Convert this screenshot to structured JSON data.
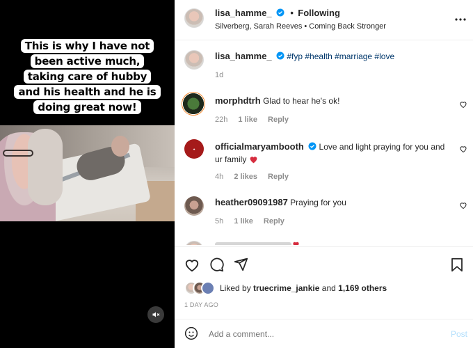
{
  "media": {
    "caption_lines": [
      "This is why I have not",
      "been active much,",
      "taking care of hubby",
      "and his health and he is",
      "doing great now!"
    ]
  },
  "header": {
    "username": "lisa_hamme_",
    "separator": "•",
    "follow_label": "Following",
    "audio": "Silverberg, Sarah Reeves • Coming Back Stronger",
    "more_icon": "more-horizontal-icon"
  },
  "caption": {
    "username": "lisa_hamme_",
    "text": "#fyp #health #marriage #love",
    "time": "1d"
  },
  "comments": [
    {
      "username": "morphdtrh",
      "text": "Glad to hear he's ok!",
      "time": "22h",
      "likes": "1 like",
      "reply": "Reply"
    },
    {
      "username": "officialmaryambooth",
      "text": "Love and light praying for you and ur family",
      "time": "4h",
      "likes": "2 likes",
      "reply": "Reply"
    },
    {
      "username": "heather09091987",
      "text": "Praying for you",
      "time": "5h",
      "likes": "1 like",
      "reply": "Reply"
    }
  ],
  "actions": {
    "liked_by_prefix": "Liked by",
    "liked_by_user": "truecrime_jankie",
    "liked_by_and": "and",
    "others": "1,169 others",
    "date": "1 DAY AGO"
  },
  "add_comment": {
    "placeholder": "Add a comment...",
    "post_label": "Post"
  },
  "colors": {
    "verified": "#0095f6",
    "post_disabled": "#b2dffc",
    "heart_red": "#ed4956"
  }
}
